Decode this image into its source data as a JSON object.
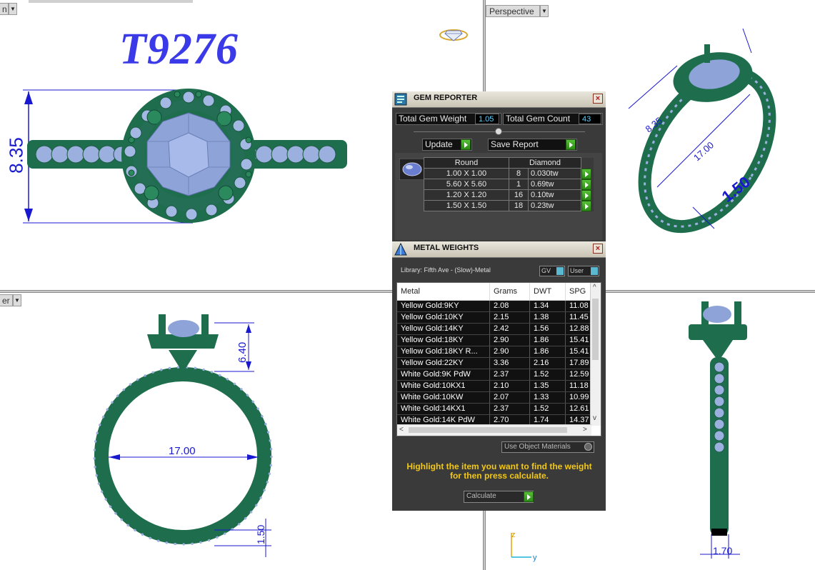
{
  "viewports": {
    "top": {
      "label": "n"
    },
    "perspective": {
      "label": "Perspective"
    },
    "front": {
      "label": "er"
    },
    "side": {
      "label": ""
    }
  },
  "design": {
    "model_number": "T9276",
    "dimensions": {
      "top_height": "8.35",
      "persp_width": "8.35",
      "persp_diameter": "17.00",
      "persp_thickness": "1.50",
      "front_head_height": "6.40",
      "front_diameter": "17.00",
      "front_band": "1.50",
      "side_width": "1.70"
    }
  },
  "axes": {
    "z": "z",
    "y": "y"
  },
  "gem_reporter": {
    "title": "GEM REPORTER",
    "total_weight_label": "Total Gem Weight",
    "total_weight_value": "1.05",
    "total_count_label": "Total Gem Count",
    "total_count_value": "43",
    "update_label": "Update",
    "save_report_label": "Save Report",
    "shape_header": "Round",
    "type_header": "Diamond",
    "rows": [
      {
        "size": "1.00 X 1.00",
        "count": "8",
        "weight": "0.030tw"
      },
      {
        "size": "5.60 X 5.60",
        "count": "1",
        "weight": "0.69tw"
      },
      {
        "size": "1.20 X 1.20",
        "count": "16",
        "weight": "0.10tw"
      },
      {
        "size": "1.50 X 1.50",
        "count": "18",
        "weight": "0.23tw"
      }
    ]
  },
  "metal_weights": {
    "title": "METAL WEIGHTS",
    "library": "Library: Fifth Ave - (Slow)-Metal",
    "gv_label": "GV",
    "user_label": "User",
    "columns": [
      "Metal",
      "Grams",
      "DWT",
      "SPG"
    ],
    "rows": [
      {
        "metal": "Yellow Gold:9KY",
        "grams": "2.08",
        "dwt": "1.34",
        "spg": "11.08"
      },
      {
        "metal": "Yellow Gold:10KY",
        "grams": "2.15",
        "dwt": "1.38",
        "spg": "11.45"
      },
      {
        "metal": "Yellow Gold:14KY",
        "grams": "2.42",
        "dwt": "1.56",
        "spg": "12.88"
      },
      {
        "metal": "Yellow Gold:18KY",
        "grams": "2.90",
        "dwt": "1.86",
        "spg": "15.41"
      },
      {
        "metal": "Yellow Gold:18KY R...",
        "grams": "2.90",
        "dwt": "1.86",
        "spg": "15.41"
      },
      {
        "metal": "Yellow Gold:22KY",
        "grams": "3.36",
        "dwt": "2.16",
        "spg": "17.89"
      },
      {
        "metal": "White Gold:9K PdW",
        "grams": "2.37",
        "dwt": "1.52",
        "spg": "12.59"
      },
      {
        "metal": "White Gold:10KX1",
        "grams": "2.10",
        "dwt": "1.35",
        "spg": "11.18"
      },
      {
        "metal": "White Gold:10KW",
        "grams": "2.07",
        "dwt": "1.33",
        "spg": "10.99"
      },
      {
        "metal": "White Gold:14KX1",
        "grams": "2.37",
        "dwt": "1.52",
        "spg": "12.61"
      },
      {
        "metal": "White Gold:14K PdW",
        "grams": "2.70",
        "dwt": "1.74",
        "spg": "14.37"
      }
    ],
    "use_object_materials_label": "Use Object Materials",
    "hint_line1": "Highlight the item you want to find the weight",
    "hint_line2": "for then press calculate.",
    "calculate_label": "Calculate"
  },
  "colors": {
    "metal_green": "#1e6e4e",
    "stone_blue": "#8ea4d8",
    "dimension_blue": "#1818d0",
    "title_blue": "#3a3ae8",
    "panel_bg": "#3a3a3a",
    "hint_yellow": "#f2c818"
  }
}
